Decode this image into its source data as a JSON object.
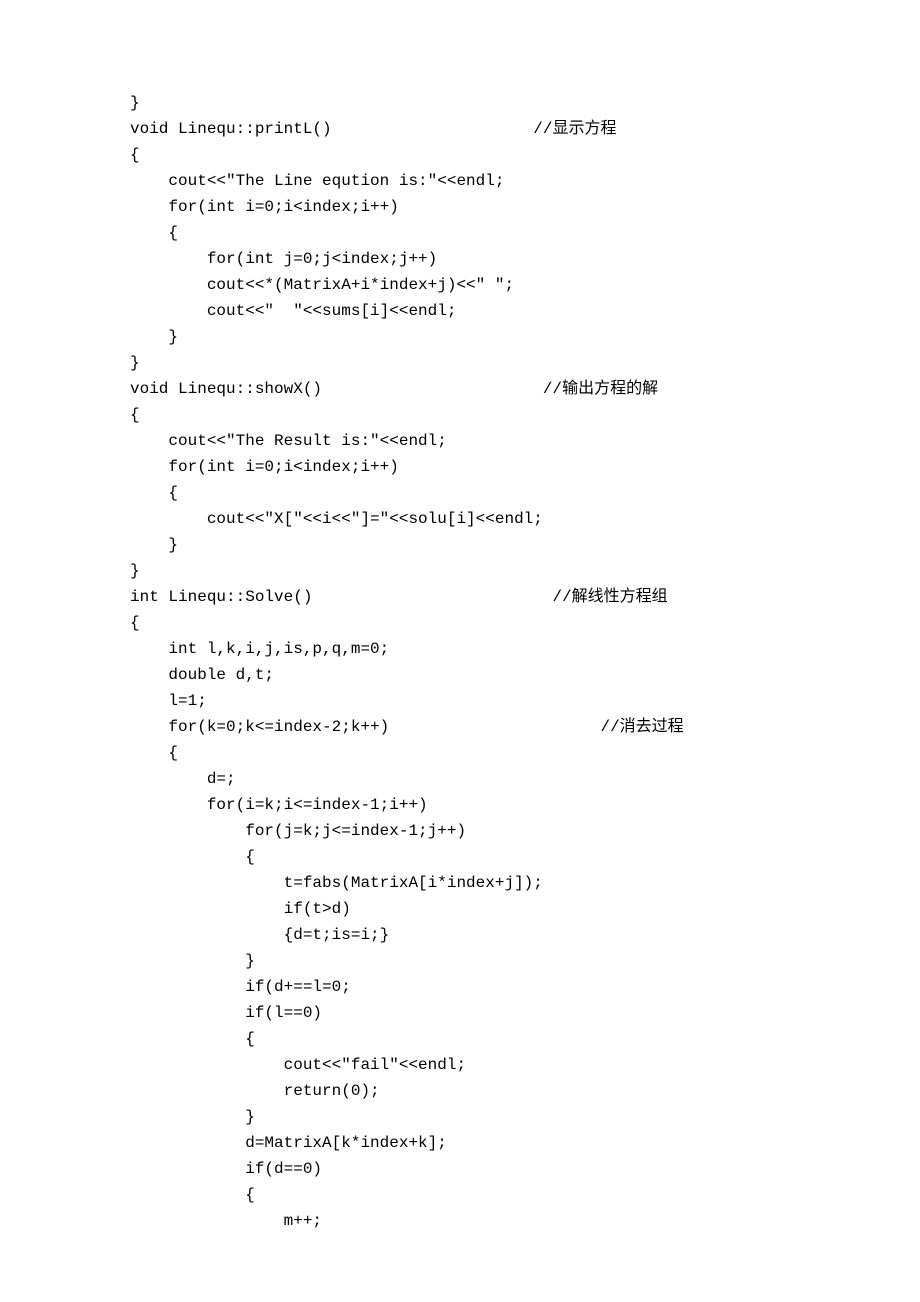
{
  "code": {
    "lines": [
      "}",
      "void Linequ::printL()                     //显示方程",
      "{",
      "    cout<<\"The Line eqution is:\"<<endl;",
      "    for(int i=0;i<index;i++)",
      "    {",
      "        for(int j=0;j<index;j++)",
      "        cout<<*(MatrixA+i*index+j)<<\" \";",
      "        cout<<\"  \"<<sums[i]<<endl;",
      "    }",
      "}",
      "void Linequ::showX()                       //输出方程的解",
      "{",
      "    cout<<\"The Result is:\"<<endl;",
      "    for(int i=0;i<index;i++)",
      "    {",
      "        cout<<\"X[\"<<i<<\"]=\"<<solu[i]<<endl;",
      "    }",
      "}",
      "int Linequ::Solve()                         //解线性方程组",
      "{",
      "    int l,k,i,j,is,p,q,m=0;",
      "    double d,t;",
      "    l=1;",
      "    for(k=0;k<=index-2;k++)                      //消去过程",
      "    {",
      "        d=;",
      "        for(i=k;i<=index-1;i++)",
      "            for(j=k;j<=index-1;j++)",
      "            {",
      "                t=fabs(MatrixA[i*index+j]);",
      "                if(t>d)",
      "                {d=t;is=i;}",
      "            }",
      "            if(d+==l=0;",
      "            if(l==0)",
      "            {",
      "                cout<<\"fail\"<<endl;",
      "                return(0);",
      "            }",
      "            d=MatrixA[k*index+k];",
      "            if(d==0)",
      "            {",
      "                m++;"
    ]
  }
}
